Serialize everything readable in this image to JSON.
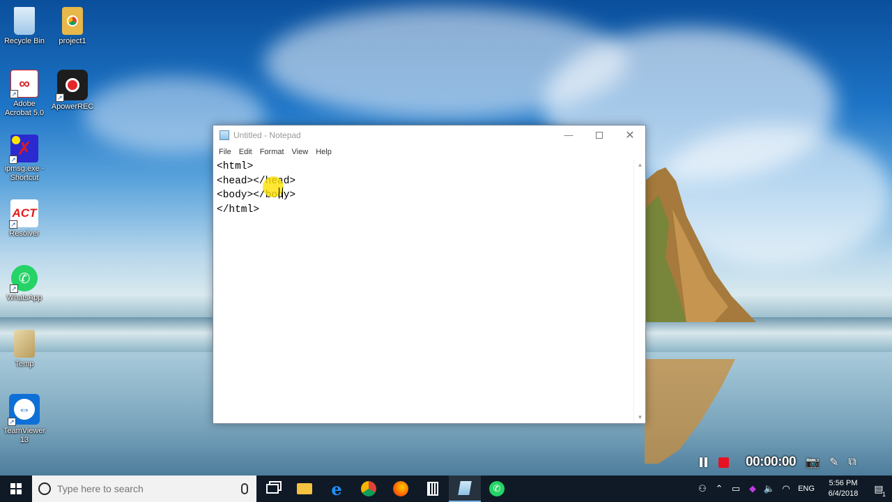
{
  "desktop": {
    "icons": [
      {
        "label": "Recycle Bin",
        "icon": "recycle-bin-icon",
        "color": "#9fc7e8"
      },
      {
        "label": "project1",
        "icon": "folder-icon",
        "color": "#e8b84a"
      },
      {
        "label": "Adobe\nAcrobat 5.0",
        "icon": "pdf-icon",
        "color": "#d8262a"
      },
      {
        "label": "ApowerREC",
        "icon": "record-icon",
        "color": "#222222"
      },
      {
        "label": "ipmsg.exe -\nShortcut",
        "icon": "ipmsg-icon",
        "color": "#2a2ad0"
      },
      {
        "label": "Resolver",
        "icon": "act-icon",
        "color": "#e01b1b"
      },
      {
        "label": "WhatsApp",
        "icon": "whatsapp-icon",
        "color": "#25d366"
      },
      {
        "label": "Temp",
        "icon": "temp-icon",
        "color": "#d9c08a"
      },
      {
        "label": "TeamViewer\n13",
        "icon": "teamviewer-icon",
        "color": "#0e6fd6"
      }
    ]
  },
  "notepad": {
    "title": "Untitled - Notepad",
    "menu": [
      "File",
      "Edit",
      "Format",
      "View",
      "Help"
    ],
    "content": "<html>\n<head></head>\n<body></body>\n</html>"
  },
  "recorder": {
    "timer": "00:00:00"
  },
  "taskbar": {
    "search_placeholder": "Type here to search",
    "tray_language": "ENG",
    "time": "5:56 PM",
    "date": "6/4/2018",
    "notification_count": "1"
  }
}
